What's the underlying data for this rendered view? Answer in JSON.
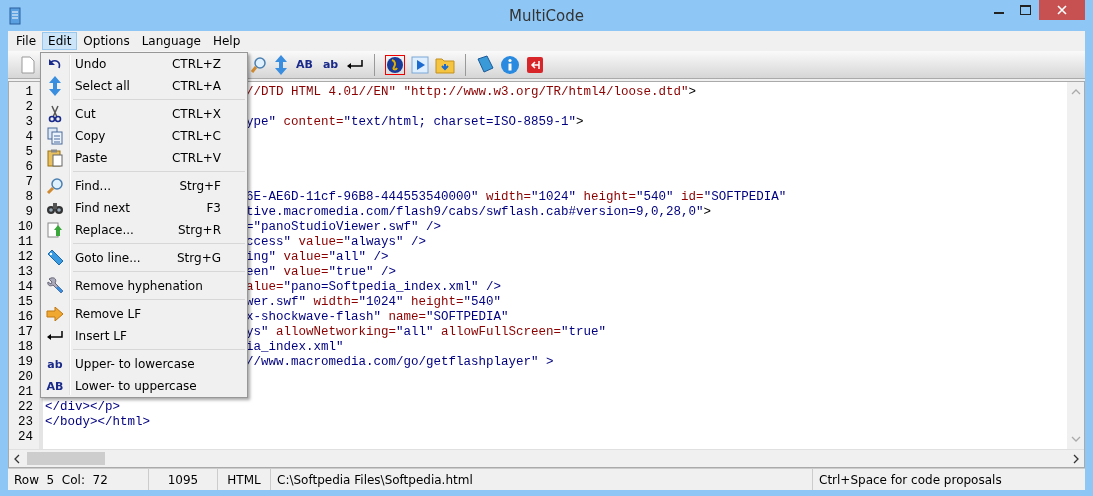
{
  "window": {
    "title": "MultiCode"
  },
  "menubar": [
    {
      "label": "File",
      "selected": false
    },
    {
      "label": "Edit",
      "selected": true
    },
    {
      "label": "Options",
      "selected": false
    },
    {
      "label": "Language",
      "selected": false
    },
    {
      "label": "Help",
      "selected": false
    }
  ],
  "toolbar": [
    {
      "kind": "new"
    },
    {
      "kind": "find"
    },
    {
      "kind": "updown"
    },
    {
      "kind": "text",
      "text": "AB"
    },
    {
      "kind": "text",
      "text": "ab"
    },
    {
      "kind": "enter"
    },
    {
      "kind": "sep"
    },
    {
      "kind": "globe"
    },
    {
      "kind": "play"
    },
    {
      "kind": "folder"
    },
    {
      "kind": "sep"
    },
    {
      "kind": "book"
    },
    {
      "kind": "info"
    },
    {
      "kind": "exit"
    }
  ],
  "edit_menu": [
    [
      {
        "label": "Undo",
        "shortcut": "CTRL+Z",
        "kind": "undo"
      },
      {
        "label": "Select all",
        "shortcut": "CTRL+A",
        "kind": "updown"
      }
    ],
    [
      {
        "label": "Cut",
        "shortcut": "CTRL+X",
        "kind": "cut"
      },
      {
        "label": "Copy",
        "shortcut": "CTRL+C",
        "kind": "copy"
      },
      {
        "label": "Paste",
        "shortcut": "CTRL+V",
        "kind": "paste"
      }
    ],
    [
      {
        "label": "Find...",
        "shortcut": "Strg+F",
        "kind": "find"
      },
      {
        "label": "Find next",
        "shortcut": "F3",
        "kind": "binoculars"
      },
      {
        "label": "Replace...",
        "shortcut": "Strg+R",
        "kind": "replace"
      }
    ],
    [
      {
        "label": "Goto line...",
        "shortcut": "Strg+G",
        "kind": "tag"
      }
    ],
    [
      {
        "label": "Remove hyphenation",
        "kind": "wrench"
      }
    ],
    [
      {
        "label": "Remove LF",
        "kind": "arrow"
      },
      {
        "label": "Insert LF",
        "kind": "enter"
      }
    ],
    [
      {
        "label": "Upper- to lowercase",
        "kind": "text",
        "text": "ab"
      },
      {
        "label": "Lower- to uppercase",
        "kind": "text",
        "text": "AB"
      }
    ]
  ],
  "editor": {
    "lines": [
      {
        "number": "1",
        "kind": "clipped",
        "segments": [
          {
            "kind": "attribute",
            "t": "//DTD HTML 4.01//EN\" \"http://www.w3.org/TR/html4/loose.dtd\""
          },
          {
            "kind": "plain",
            "t": ">"
          }
        ]
      },
      {
        "number": "2"
      },
      {
        "number": "3",
        "kind": "clipped",
        "segments": [
          {
            "kind": "value",
            "t": "ype\" "
          },
          {
            "kind": "attribute",
            "t": "content="
          },
          {
            "kind": "value",
            "t": "\"text/html; charset=ISO-8859-1\""
          },
          {
            "kind": "plain",
            "t": ">"
          }
        ]
      },
      {
        "number": "4"
      },
      {
        "number": "5"
      },
      {
        "number": "6"
      },
      {
        "number": "7"
      },
      {
        "number": "8",
        "kind": "clipped",
        "segments": [
          {
            "kind": "value",
            "t": "6E-AE6D-11cf-96B8-444553540000\" "
          },
          {
            "kind": "attribute",
            "t": "width="
          },
          {
            "kind": "value",
            "t": "\"1024\" "
          },
          {
            "kind": "attribute",
            "t": "height="
          },
          {
            "kind": "value",
            "t": "\"540\" "
          },
          {
            "kind": "attribute",
            "t": "id="
          },
          {
            "kind": "value",
            "t": "\"SOFTPEDIA\""
          }
        ]
      },
      {
        "number": "9",
        "kind": "clipped",
        "segments": [
          {
            "kind": "value",
            "t": "tive.macromedia.com/flash9/cabs/swflash.cab#version=9,0,28,0\""
          },
          {
            "kind": "plain",
            "t": ">"
          }
        ]
      },
      {
        "number": "10",
        "kind": "clipped",
        "segments": [
          {
            "kind": "value",
            "t": "=\"panoStudioViewer.swf\" />"
          }
        ]
      },
      {
        "number": "11",
        "kind": "clipped",
        "segments": [
          {
            "kind": "value",
            "t": "ccess\" "
          },
          {
            "kind": "attribute",
            "t": "value="
          },
          {
            "kind": "value",
            "t": "\"always\" />"
          }
        ]
      },
      {
        "number": "12",
        "kind": "clipped",
        "segments": [
          {
            "kind": "value",
            "t": "ing\" "
          },
          {
            "kind": "attribute",
            "t": "value="
          },
          {
            "kind": "value",
            "t": "\"all\" />"
          }
        ]
      },
      {
        "number": "13",
        "kind": "clipped",
        "segments": [
          {
            "kind": "value",
            "t": "een\" "
          },
          {
            "kind": "attribute",
            "t": "value="
          },
          {
            "kind": "value",
            "t": "\"true\" />"
          }
        ]
      },
      {
        "number": "14",
        "kind": "clipped",
        "segments": [
          {
            "kind": "attribute",
            "t": "alue="
          },
          {
            "kind": "value",
            "t": "\"pano=Softpedia_index.xml\" />"
          }
        ]
      },
      {
        "number": "15",
        "kind": "clipped",
        "segments": [
          {
            "kind": "value",
            "t": "wer.swf\" "
          },
          {
            "kind": "attribute",
            "t": "width="
          },
          {
            "kind": "value",
            "t": "\"1024\" "
          },
          {
            "kind": "attribute",
            "t": "height="
          },
          {
            "kind": "value",
            "t": "\"540\""
          }
        ]
      },
      {
        "number": "16",
        "kind": "clipped",
        "segments": [
          {
            "kind": "value",
            "t": "x-shockwave-flash\" "
          },
          {
            "kind": "attribute",
            "t": "name="
          },
          {
            "kind": "value",
            "t": "\"SOFTPEDIA\""
          }
        ]
      },
      {
        "number": "17",
        "kind": "clipped",
        "segments": [
          {
            "kind": "value",
            "t": "ys\" "
          },
          {
            "kind": "attribute",
            "t": "allowNetworking="
          },
          {
            "kind": "value",
            "t": "\"all\" "
          },
          {
            "kind": "attribute",
            "t": "allowFullScreen="
          },
          {
            "kind": "value",
            "t": "\"true\""
          }
        ]
      },
      {
        "number": "18",
        "kind": "clipped",
        "segments": [
          {
            "kind": "value",
            "t": "ia_index.xml\""
          }
        ]
      },
      {
        "number": "19",
        "kind": "clipped",
        "segments": [
          {
            "kind": "value",
            "t": "//www.macromedia.com/go/getflashplayer\" >"
          }
        ]
      },
      {
        "number": "20"
      },
      {
        "number": "21"
      },
      {
        "number": "22",
        "kind": "full",
        "segments": [
          {
            "kind": "value",
            "t": "</div></p>"
          }
        ]
      },
      {
        "number": "23",
        "kind": "full",
        "segments": [
          {
            "kind": "value",
            "t": "</body></html>"
          }
        ]
      },
      {
        "number": "24"
      }
    ]
  },
  "status_bar": [
    "Row  5  Col:  72",
    "1095",
    "HTML",
    "C:\\Softpedia Files\\Softpedia.html",
    "Ctrl+Space for code proposals"
  ]
}
